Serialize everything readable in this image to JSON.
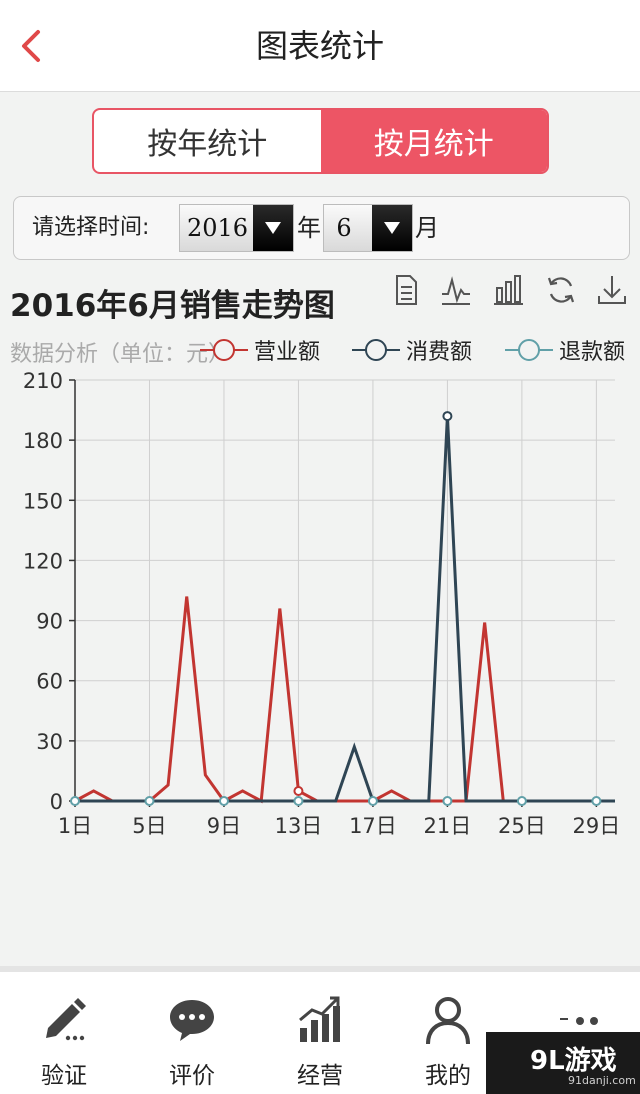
{
  "header": {
    "title": "图表统计"
  },
  "toggle": {
    "by_year": "按年统计",
    "by_month": "按月统计",
    "active": "by_month"
  },
  "picker": {
    "label": "请选择时间:",
    "year": "2016",
    "year_unit": "年",
    "month": "6",
    "month_unit": "月"
  },
  "chart_header": {
    "title": "2016年6月销售走势图",
    "subtitle": "数据分析（单位：元）",
    "tools": [
      "document-icon",
      "line-chart-icon",
      "bar-chart-icon",
      "refresh-icon",
      "download-icon"
    ]
  },
  "colors": {
    "accent": "#ed5565",
    "revenue": "#c23531",
    "consumption": "#2f4554",
    "refund": "#61a0a8"
  },
  "chart_data": {
    "type": "line",
    "title": "2016年6月销售走势图",
    "subtitle": "数据分析（单位：元）",
    "x": [
      1,
      2,
      3,
      4,
      5,
      6,
      7,
      8,
      9,
      10,
      11,
      12,
      13,
      14,
      15,
      16,
      17,
      18,
      19,
      20,
      21,
      22,
      23,
      24,
      25,
      26,
      27,
      28,
      29,
      30
    ],
    "xticks": [
      "1日",
      "5日",
      "9日",
      "13日",
      "17日",
      "21日",
      "25日",
      "29日"
    ],
    "xtick_values": [
      1,
      5,
      9,
      13,
      17,
      21,
      25,
      29
    ],
    "ylim": [
      0,
      210
    ],
    "yticks": [
      "0",
      "30",
      "60",
      "90",
      "120",
      "150",
      "180",
      "210"
    ],
    "ytick_values": [
      0,
      30,
      60,
      90,
      120,
      150,
      180,
      210
    ],
    "grid": true,
    "legend": "top",
    "series": [
      {
        "name": "营业额",
        "color": "#c23531",
        "values": [
          0,
          5,
          0,
          0,
          0,
          8,
          102,
          13,
          0,
          5,
          0,
          96,
          5,
          0,
          0,
          0,
          0,
          5,
          0,
          0,
          0,
          0,
          89,
          0,
          0,
          0,
          0,
          0,
          0,
          0
        ]
      },
      {
        "name": "消费额",
        "color": "#2f4554",
        "values": [
          0,
          0,
          0,
          0,
          0,
          0,
          0,
          0,
          0,
          0,
          0,
          0,
          0,
          0,
          0,
          27,
          0,
          0,
          0,
          0,
          192,
          0,
          0,
          0,
          0,
          0,
          0,
          0,
          0,
          0
        ]
      },
      {
        "name": "退款额",
        "color": "#61a0a8",
        "values": [
          0,
          0,
          0,
          0,
          0,
          0,
          0,
          0,
          0,
          0,
          0,
          0,
          0,
          0,
          0,
          0,
          0,
          0,
          0,
          0,
          0,
          0,
          0,
          0,
          0,
          0,
          0,
          0,
          0,
          0
        ]
      }
    ]
  },
  "nav": [
    {
      "label": "验证",
      "icon": "pencil-icon"
    },
    {
      "label": "评价",
      "icon": "chat-bubble-icon"
    },
    {
      "label": "经营",
      "icon": "growth-chart-icon"
    },
    {
      "label": "我的",
      "icon": "user-icon"
    },
    {
      "label": "",
      "icon": "more-icon"
    }
  ],
  "watermark": {
    "main": "9L游戏",
    "sub": "91danji.com"
  }
}
